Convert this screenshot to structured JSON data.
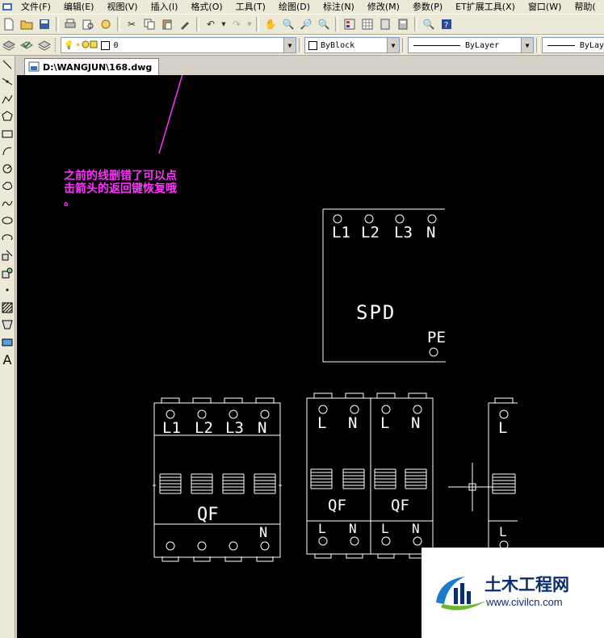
{
  "menu": {
    "items": [
      "文件(F)",
      "编辑(E)",
      "视图(V)",
      "插入(I)",
      "格式(O)",
      "工具(T)",
      "绘图(D)",
      "标注(N)",
      "修改(M)",
      "参数(P)",
      "ET扩展工具(X)",
      "窗口(W)",
      "帮助("
    ]
  },
  "properties": {
    "layer_value": "0",
    "color_value": "ByBlock",
    "linetype_value": "ByLayer",
    "lineweight_value": "ByLay"
  },
  "document_tab": {
    "label": "D:\\WANGJUN\\168.dwg"
  },
  "annotation": {
    "text": "之前的线删错了可以点\n击箭头的返回键恢复哦\n。",
    "color": "#ff33ff"
  },
  "drawing": {
    "spd": {
      "terminals": [
        "L1",
        "L2",
        "L3",
        "N"
      ],
      "label": "SPD",
      "pe_label": "PE"
    },
    "qf4": {
      "top_terminals": [
        "L1",
        "L2",
        "L3",
        "N"
      ],
      "label": "QF",
      "bottom_label": "N"
    },
    "qf2a": {
      "top_terminals": [
        "L",
        "N"
      ],
      "label": "QF",
      "bottom_terminals": [
        "L",
        "N"
      ]
    },
    "qf2b": {
      "top_terminals": [
        "L",
        "N"
      ],
      "label": "QF",
      "bottom_terminals": [
        "L",
        "N"
      ]
    },
    "qf1": {
      "top_terminals": [
        "L"
      ],
      "bottom_terminals": [
        "L"
      ]
    }
  },
  "watermark": {
    "title": "土木工程网",
    "url": "www.civilcn.com"
  }
}
